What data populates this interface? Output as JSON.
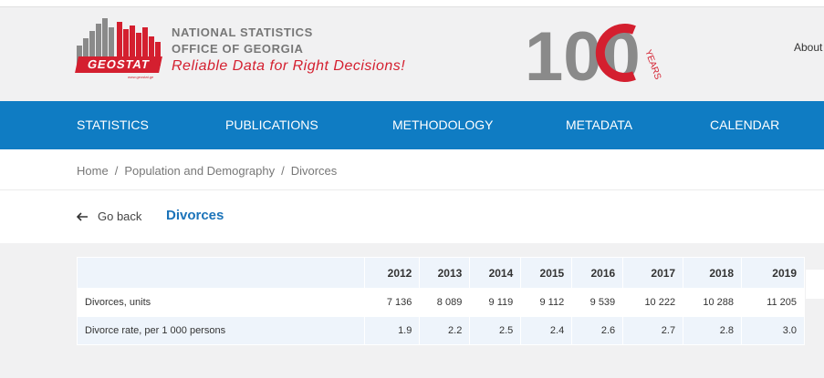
{
  "header": {
    "logo_text": "GEOSTAT",
    "logo_url": "www.geostat.ge",
    "org_line1": "NATIONAL STATISTICS",
    "org_line2": "OFFICE OF GEORGIA",
    "slogan": "Reliable Data for Right Decisions!",
    "anniversary_number": "100",
    "anniversary_word": "YEARS",
    "about_label": "About"
  },
  "colors": {
    "brand_red": "#d41f2f",
    "nav_blue": "#0f7cc3",
    "title_blue": "#1b73b9",
    "row_alt": "#eef4fb"
  },
  "nav": {
    "items": [
      {
        "label": "STATISTICS"
      },
      {
        "label": "PUBLICATIONS"
      },
      {
        "label": "METHODOLOGY"
      },
      {
        "label": "METADATA"
      },
      {
        "label": "CALENDAR"
      }
    ]
  },
  "breadcrumb": {
    "items": [
      "Home",
      "Population and Demography",
      "Divorces"
    ],
    "separator": "/"
  },
  "page": {
    "back_label": "Go back",
    "title": "Divorces"
  },
  "table": {
    "columns": [
      "",
      "2012",
      "2013",
      "2014",
      "2015",
      "2016",
      "2017",
      "2018",
      "2019"
    ],
    "rows": [
      {
        "label": "Divorces, units",
        "values": [
          "7 136",
          "8 089",
          "9 119",
          "9 112",
          "9 539",
          "10 222",
          "10 288",
          "11 205"
        ]
      },
      {
        "label": "Divorce rate, per 1 000 persons",
        "values": [
          "1.9",
          "2.2",
          "2.5",
          "2.4",
          "2.6",
          "2.7",
          "2.8",
          "3.0"
        ]
      }
    ]
  }
}
